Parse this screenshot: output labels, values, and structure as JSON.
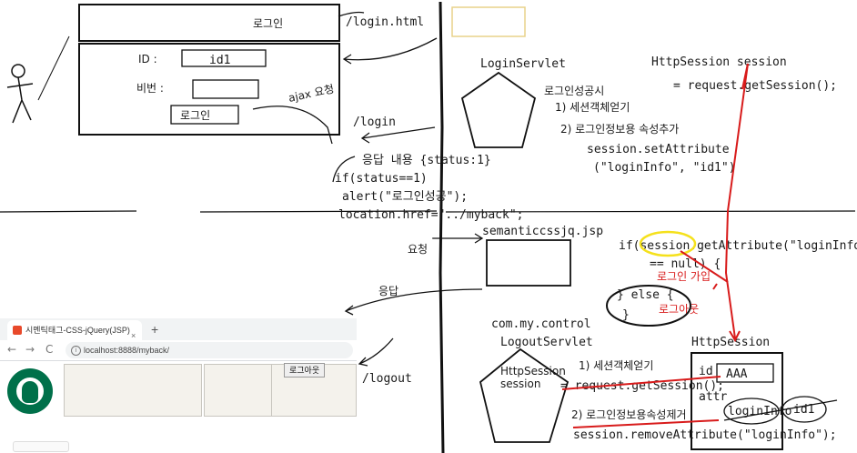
{
  "login_form": {
    "title": "로그인",
    "id_label": "ID :",
    "id_value": "id1",
    "pw_label": "비번 :",
    "button_label": "로그인"
  },
  "arrows": {
    "login_html": "/login.html",
    "ajax_request": "ajax 요청",
    "login_url": "/login",
    "logout_url": "/logout",
    "request": "요청",
    "response": "응답"
  },
  "response_code": {
    "line1": "응답 내용 {status:1}",
    "line2": "if(status==1)",
    "line3": "alert(\"로그인성공\");",
    "line4": "location.href=\"../myback\";"
  },
  "login_servlet": {
    "name": "LoginServlet",
    "on_success": "로그인성공시",
    "step1": "1) 세션객체얻기",
    "step2": "2) 로그인정보용 속성추가",
    "code1": "session.setAttribute",
    "code2": "(\"loginInfo\", \"id1\")"
  },
  "http_session_code": {
    "line1": "HttpSession session",
    "line2": "= request.getSession();"
  },
  "semantic_jsp": {
    "name": "semanticcssjq.jsp",
    "line1": "if(session.getAttribute(\"loginInfo\")",
    "line2": "== null) {",
    "login_note": "로그인 가입",
    "else_line": "} else {",
    "logout_note": "로그아웃",
    "close": "}"
  },
  "logout_servlet": {
    "package": "com.my.control",
    "name": "LogoutServlet",
    "inner1": "HttpSession",
    "inner2": "session",
    "step1": "1) 세션객체얻기",
    "code1": "= request.getSession();",
    "step2": "2) 로그인정보용속성제거",
    "code2": "session.removeAttribute(\"loginInfo\");"
  },
  "session_box": {
    "title": "HttpSession",
    "id_label": "id",
    "id_value": "AAA",
    "attr_label": "attr",
    "attr_key": "loginInfo",
    "attr_value": "id1"
  },
  "browser": {
    "tab_title": "시멘틱태그-CSS-jQuery(JSP)",
    "tab_close": "×",
    "new_tab": "+",
    "back": "←",
    "forward": "→",
    "reload": "C",
    "info": "i",
    "url": "localhost:8888/myback/",
    "logout_button": "로그아웃"
  }
}
